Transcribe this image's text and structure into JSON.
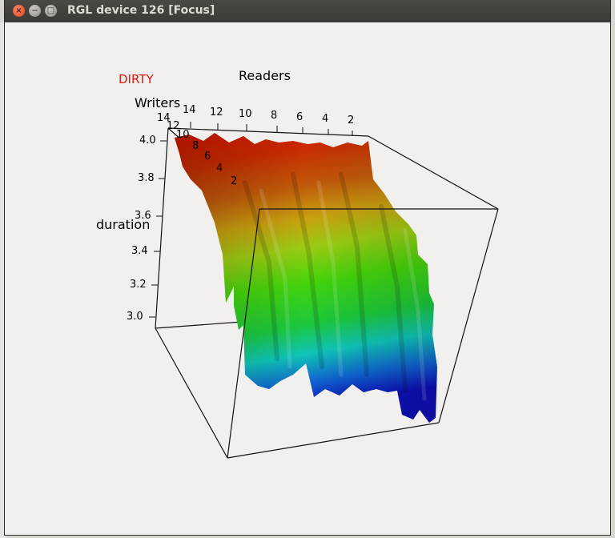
{
  "window": {
    "title": "RGL device 126 [Focus]",
    "controls": {
      "close_glyph": "×",
      "minimize_glyph": "−",
      "maximize_glyph": "□"
    }
  },
  "plot": {
    "title": "DIRTY",
    "title_color": "#e8160c",
    "x_axis_label": "Readers",
    "y_axis_label": "Writers",
    "z_axis_label": "duration",
    "readers_ticks": [
      "14",
      "12",
      "10",
      "8",
      "6",
      "4",
      "2"
    ],
    "writers_ticks": [
      "14",
      "12",
      "10",
      "8",
      "6",
      "4",
      "2"
    ],
    "duration_ticks": [
      "4.0",
      "3.8",
      "3.6",
      "3.4",
      "3.2",
      "3.0"
    ],
    "colormap": "rainbow (red high to blue low)"
  },
  "chart_data": {
    "type": "surface3d",
    "title": "DIRTY",
    "x_label": "Readers",
    "y_label": "Writers",
    "z_label": "duration",
    "x_ticks": [
      14,
      12,
      10,
      8,
      6,
      4,
      2
    ],
    "y_ticks": [
      14,
      12,
      10,
      8,
      6,
      4,
      2
    ],
    "z_ticks": [
      4.0,
      3.8,
      3.6,
      3.4,
      3.2,
      3.0
    ],
    "z_range": [
      3.0,
      4.0
    ]
  }
}
